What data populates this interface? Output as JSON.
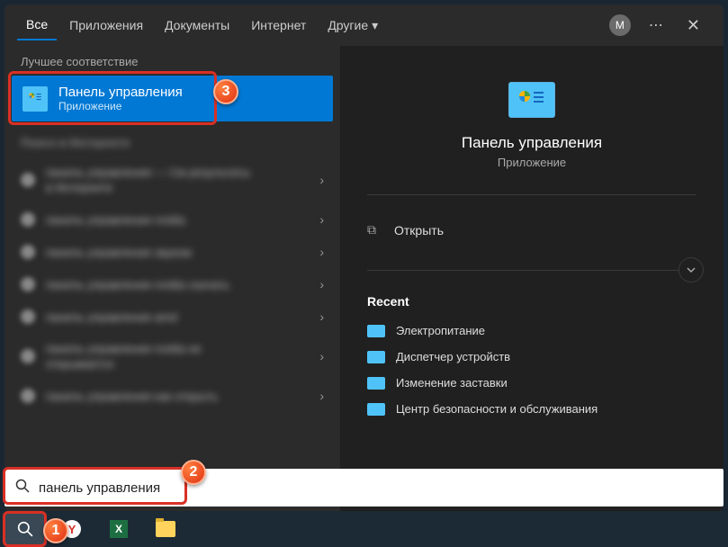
{
  "tabs": {
    "all": "Все",
    "apps": "Приложения",
    "documents": "Документы",
    "internet": "Интернет",
    "more": "Другие"
  },
  "avatar_letter": "М",
  "left": {
    "bestmatch_label": "Лучшее соответствие",
    "result_title": "Панель управления",
    "result_sub": "Приложение"
  },
  "detail": {
    "title": "Панель управления",
    "sub": "Приложение",
    "open": "Открыть",
    "recent_label": "Recent",
    "recent": [
      "Электропитание",
      "Диспетчер устройств",
      "Изменение заставки",
      "Центр безопасности и обслуживания"
    ]
  },
  "search": {
    "value": "панель управления"
  },
  "markers": {
    "m1": "1",
    "m2": "2",
    "m3": "3"
  }
}
